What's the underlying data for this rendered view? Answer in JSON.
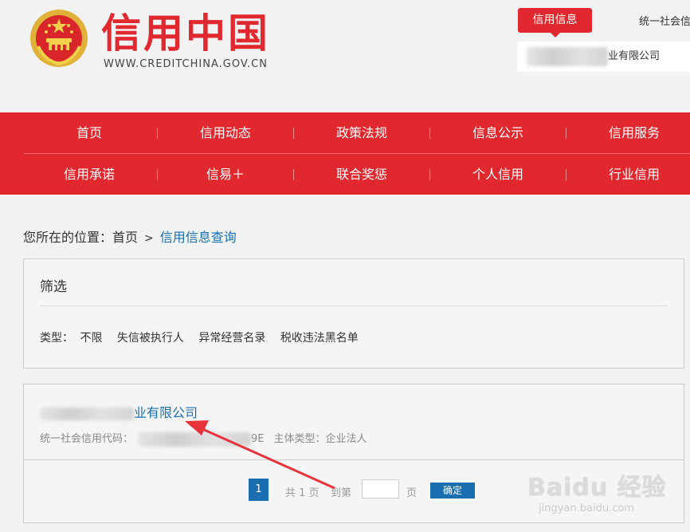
{
  "header": {
    "title": "信用中国",
    "url": "WWW.CREDITCHINA.GOV.CN",
    "search_tab_active": "信用信息",
    "search_tab_other": "统一社会信",
    "search_value_visible": "业有限公司"
  },
  "nav": {
    "row1": [
      "首页",
      "信用动态",
      "政策法规",
      "信息公示",
      "信用服务"
    ],
    "row2": [
      "信用承诺",
      "信易＋",
      "联合奖惩",
      "个人信用",
      "行业信用"
    ]
  },
  "breadcrumb": {
    "prefix": "您所在的位置：",
    "home": "首页",
    "separator": ">",
    "current": "信用信息查询"
  },
  "filter": {
    "title": "筛选",
    "type_label": "类型：",
    "options": [
      "不限",
      "失信被执行人",
      "异常经营名录",
      "税收违法黑名单"
    ]
  },
  "result": {
    "name_visible": "业有限公司",
    "code_label": "统一社会信用代码：",
    "code_visible_suffix": "9E",
    "entity_type_label": "主体类型：",
    "entity_type_value": "企业法人"
  },
  "pager": {
    "current_page": "1",
    "total_text": "共 1 页",
    "goto_text": "到第",
    "page_unit": "页",
    "confirm_label": "确定"
  },
  "watermark": {
    "brand": "Baidu 经验",
    "url": "jingyan.baidu.com"
  },
  "colors": {
    "brand_red": "#e0282e",
    "link_blue": "#1a6fb0"
  }
}
